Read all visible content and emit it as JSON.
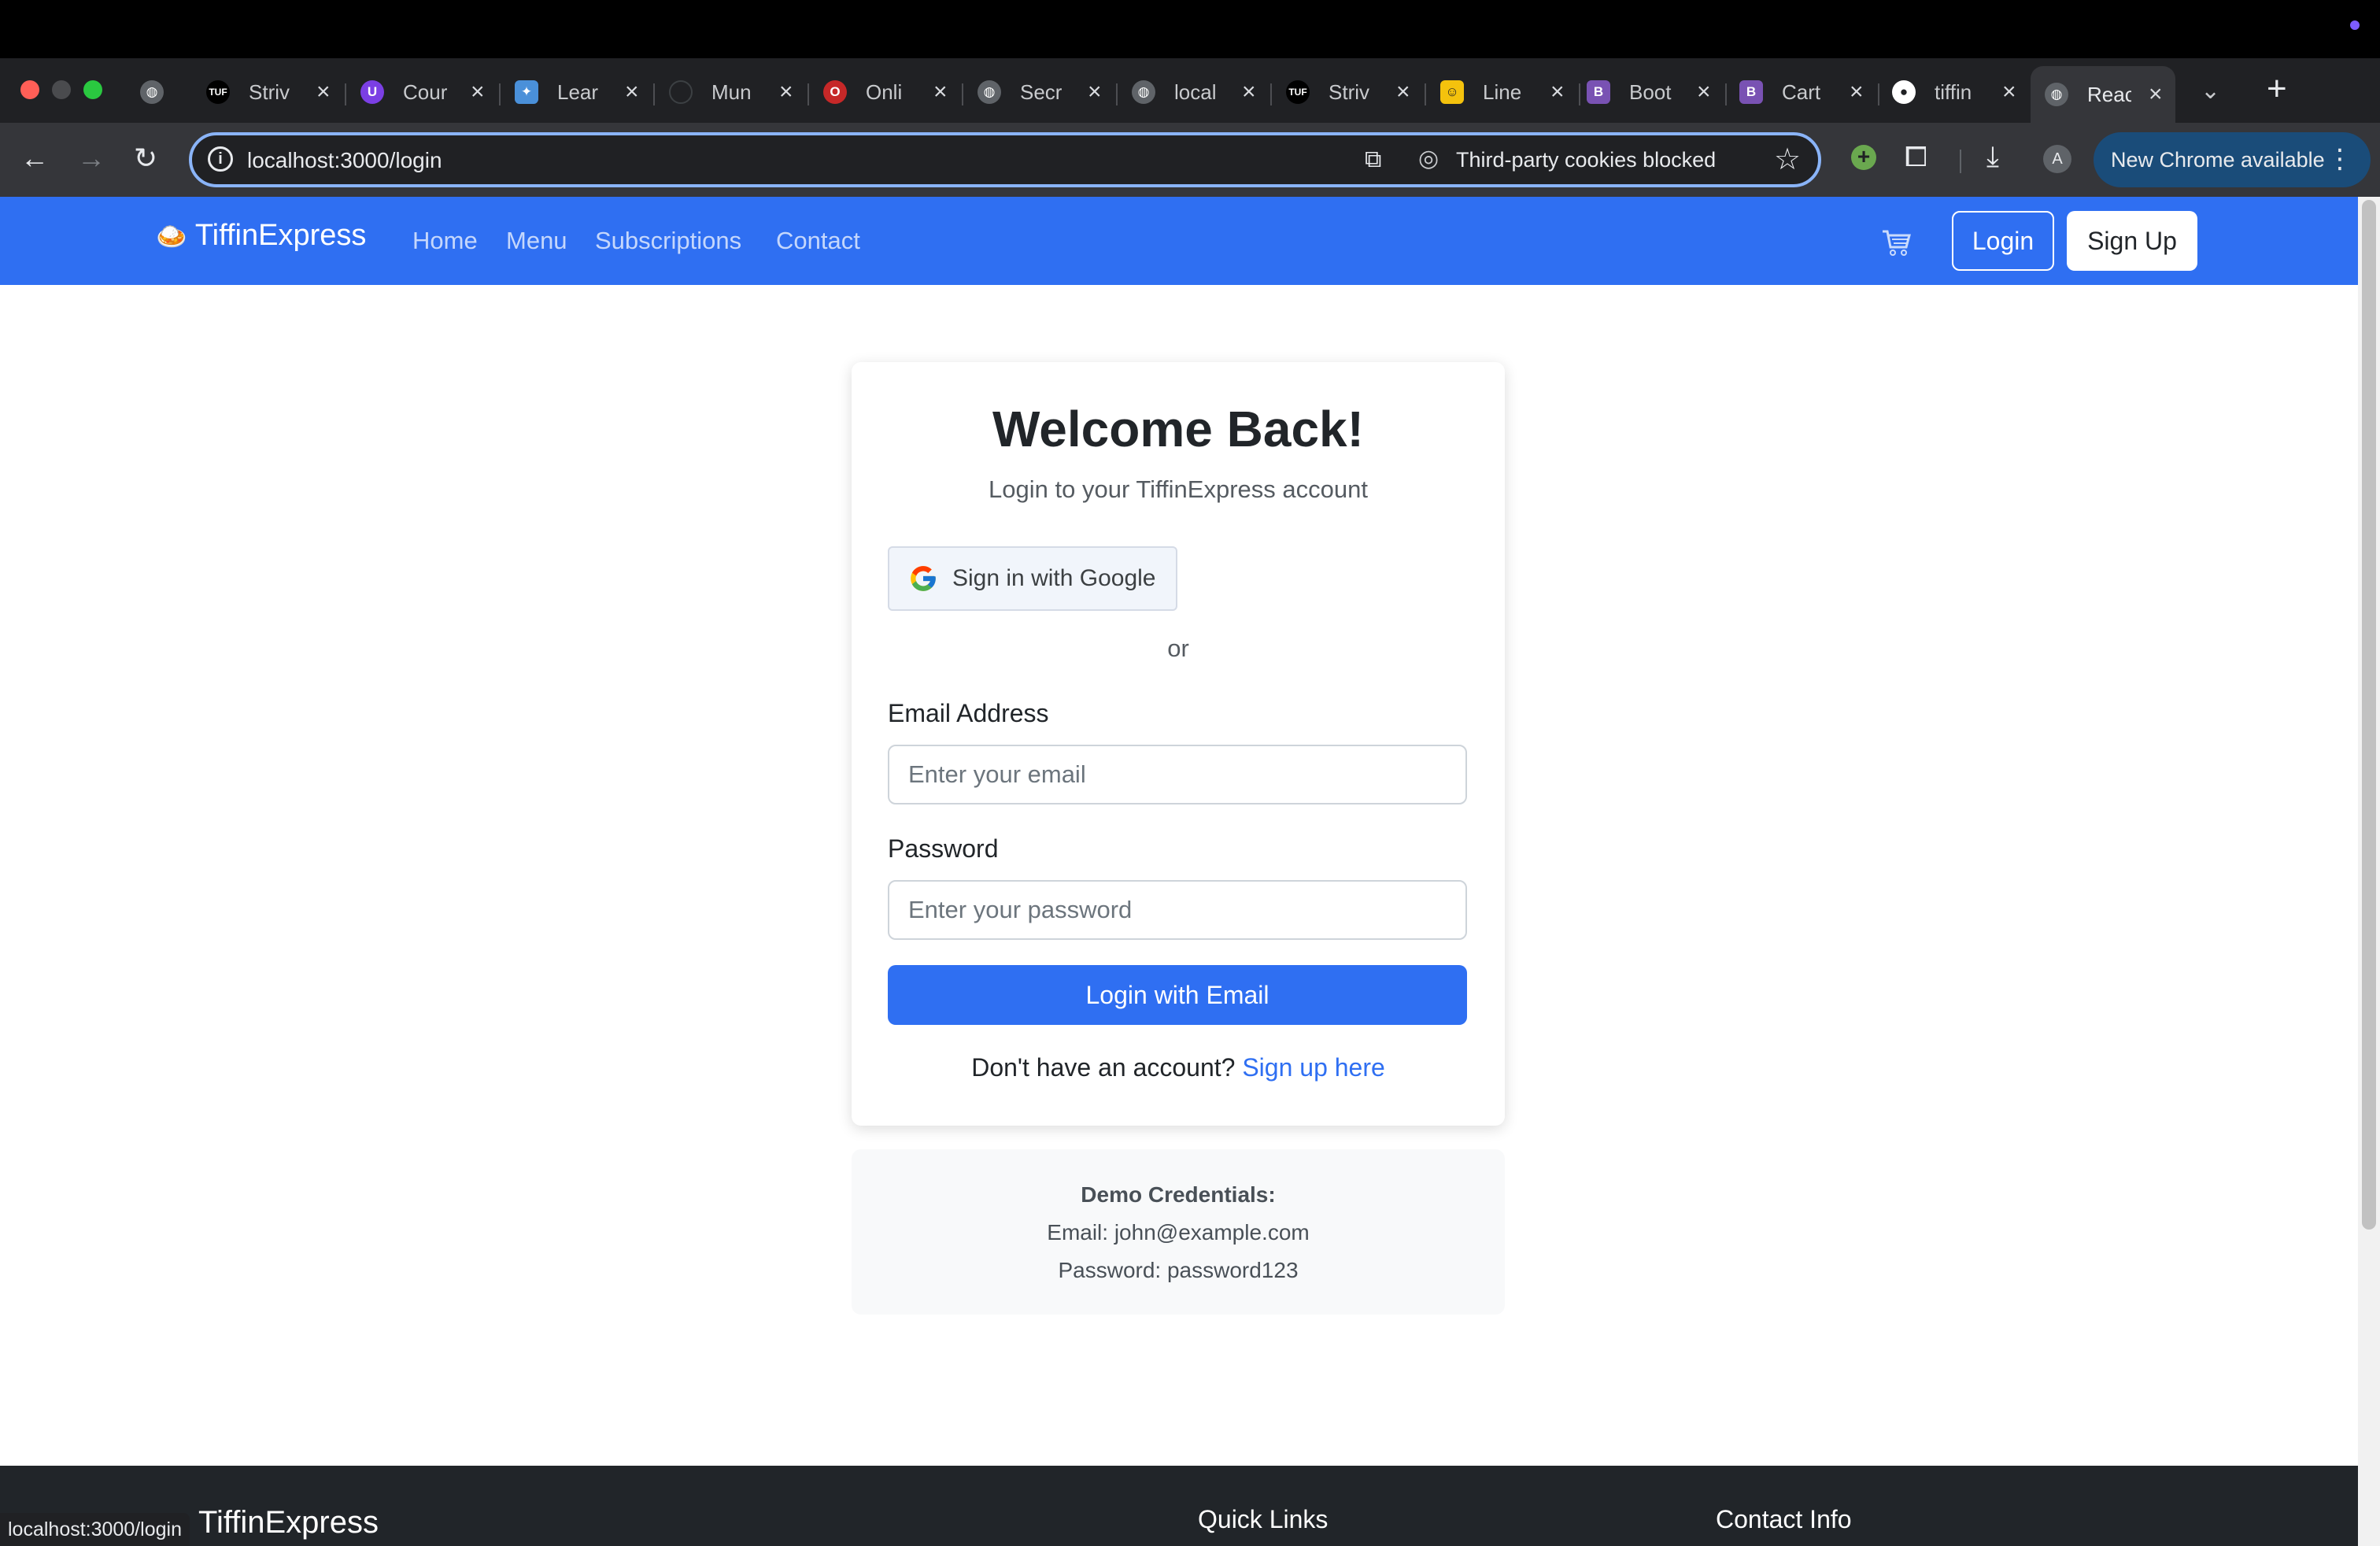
{
  "browser": {
    "tabs": [
      {
        "label": "",
        "icon": "globe-icon",
        "color": "#5f6368"
      },
      {
        "label": "Striv",
        "icon": "tuf-icon",
        "color": "#000000"
      },
      {
        "label": "Cour",
        "icon": "course-icon",
        "color": "#7b3fe4"
      },
      {
        "label": "Lear",
        "icon": "learn-icon",
        "color": "#4a90d9"
      },
      {
        "label": "Mun",
        "icon": "github-icon",
        "color": "#202124"
      },
      {
        "label": "Onli",
        "icon": "opera-icon",
        "color": "#c62828"
      },
      {
        "label": "Secr",
        "icon": "globe-icon",
        "color": "#5f6368"
      },
      {
        "label": "local",
        "icon": "globe-icon",
        "color": "#5f6368"
      },
      {
        "label": "Striv",
        "icon": "tuf-icon",
        "color": "#000000"
      },
      {
        "label": "Line",
        "icon": "line-icon",
        "color": "#f4c20d"
      },
      {
        "label": "Boot",
        "icon": "bootstrap-icon",
        "color": "#7952b3"
      },
      {
        "label": "Cart",
        "icon": "bootstrap-icon",
        "color": "#7952b3"
      },
      {
        "label": "tiffin",
        "icon": "github-icon",
        "color": "#ffffff"
      },
      {
        "label": "Reac",
        "icon": "globe-icon",
        "color": "#5f6368",
        "active": true
      }
    ],
    "url": "localhost:3000/login",
    "cookies_text": "Third-party cookies blocked",
    "avatar_letter": "A",
    "update_label": "New Chrome available",
    "status_url": "localhost:3000/login"
  },
  "nav": {
    "brand": "TiffinExpress",
    "links": [
      "Home",
      "Menu",
      "Subscriptions",
      "Contact"
    ],
    "login": "Login",
    "signup": "Sign Up"
  },
  "login": {
    "title": "Welcome Back!",
    "subtitle": "Login to your TiffinExpress account",
    "google_label": "Sign in with Google",
    "or": "or",
    "email_label": "Email Address",
    "email_placeholder": "Enter your email",
    "password_label": "Password",
    "password_placeholder": "Enter your password",
    "submit": "Login with Email",
    "no_account": "Don't have an account?",
    "signup_link": "Sign up here"
  },
  "demo": {
    "title": "Demo Credentials:",
    "email": "Email: john@example.com",
    "password": "Password: password123"
  },
  "footer": {
    "brand": "TiffinExpress",
    "quick_links": "Quick Links",
    "contact_info": "Contact Info"
  },
  "colors": {
    "primary": "#2f6ff2",
    "footer_bg": "#212529",
    "chrome_dark": "#202124"
  }
}
